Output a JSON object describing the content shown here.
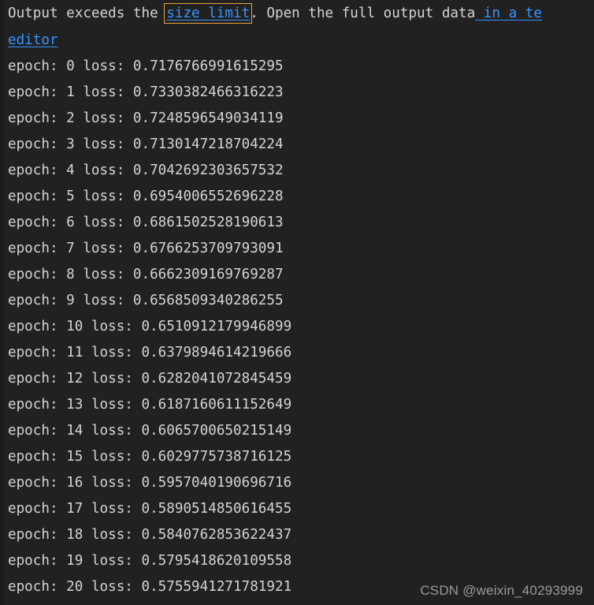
{
  "cell": {
    "background_color": "#212121",
    "text_color": "#d4d4d4",
    "link_color": "#3794ff",
    "focus_border_color": "#e8a33d"
  },
  "notice": {
    "part1": "Output exceeds the ",
    "link_size_limit": "size limit",
    "part2": ". Open the full output data",
    "link_editor_head": " in a te",
    "link_editor_tail": "editor"
  },
  "log": {
    "epoch_label": "epoch:",
    "loss_label": "loss:",
    "entries": [
      {
        "epoch": "0",
        "loss": "0.7176766991615295"
      },
      {
        "epoch": "1",
        "loss": "0.7330382466316223"
      },
      {
        "epoch": "2",
        "loss": "0.7248596549034119"
      },
      {
        "epoch": "3",
        "loss": "0.7130147218704224"
      },
      {
        "epoch": "4",
        "loss": "0.7042692303657532"
      },
      {
        "epoch": "5",
        "loss": "0.6954006552696228"
      },
      {
        "epoch": "6",
        "loss": "0.6861502528190613"
      },
      {
        "epoch": "7",
        "loss": "0.6766253709793091"
      },
      {
        "epoch": "8",
        "loss": "0.6662309169769287"
      },
      {
        "epoch": "9",
        "loss": "0.6568509340286255"
      },
      {
        "epoch": "10",
        "loss": "0.6510912179946899"
      },
      {
        "epoch": "11",
        "loss": "0.6379894614219666"
      },
      {
        "epoch": "12",
        "loss": "0.6282041072845459"
      },
      {
        "epoch": "13",
        "loss": "0.6187160611152649"
      },
      {
        "epoch": "14",
        "loss": "0.6065700650215149"
      },
      {
        "epoch": "15",
        "loss": "0.6029775738716125"
      },
      {
        "epoch": "16",
        "loss": "0.5957040190696716"
      },
      {
        "epoch": "17",
        "loss": "0.5890514850616455"
      },
      {
        "epoch": "18",
        "loss": "0.5840762853622437"
      },
      {
        "epoch": "19",
        "loss": "0.5795418620109558"
      },
      {
        "epoch": "20",
        "loss": "0.5755941271781921"
      }
    ]
  },
  "watermark": {
    "text": "CSDN @weixin_40293999"
  }
}
